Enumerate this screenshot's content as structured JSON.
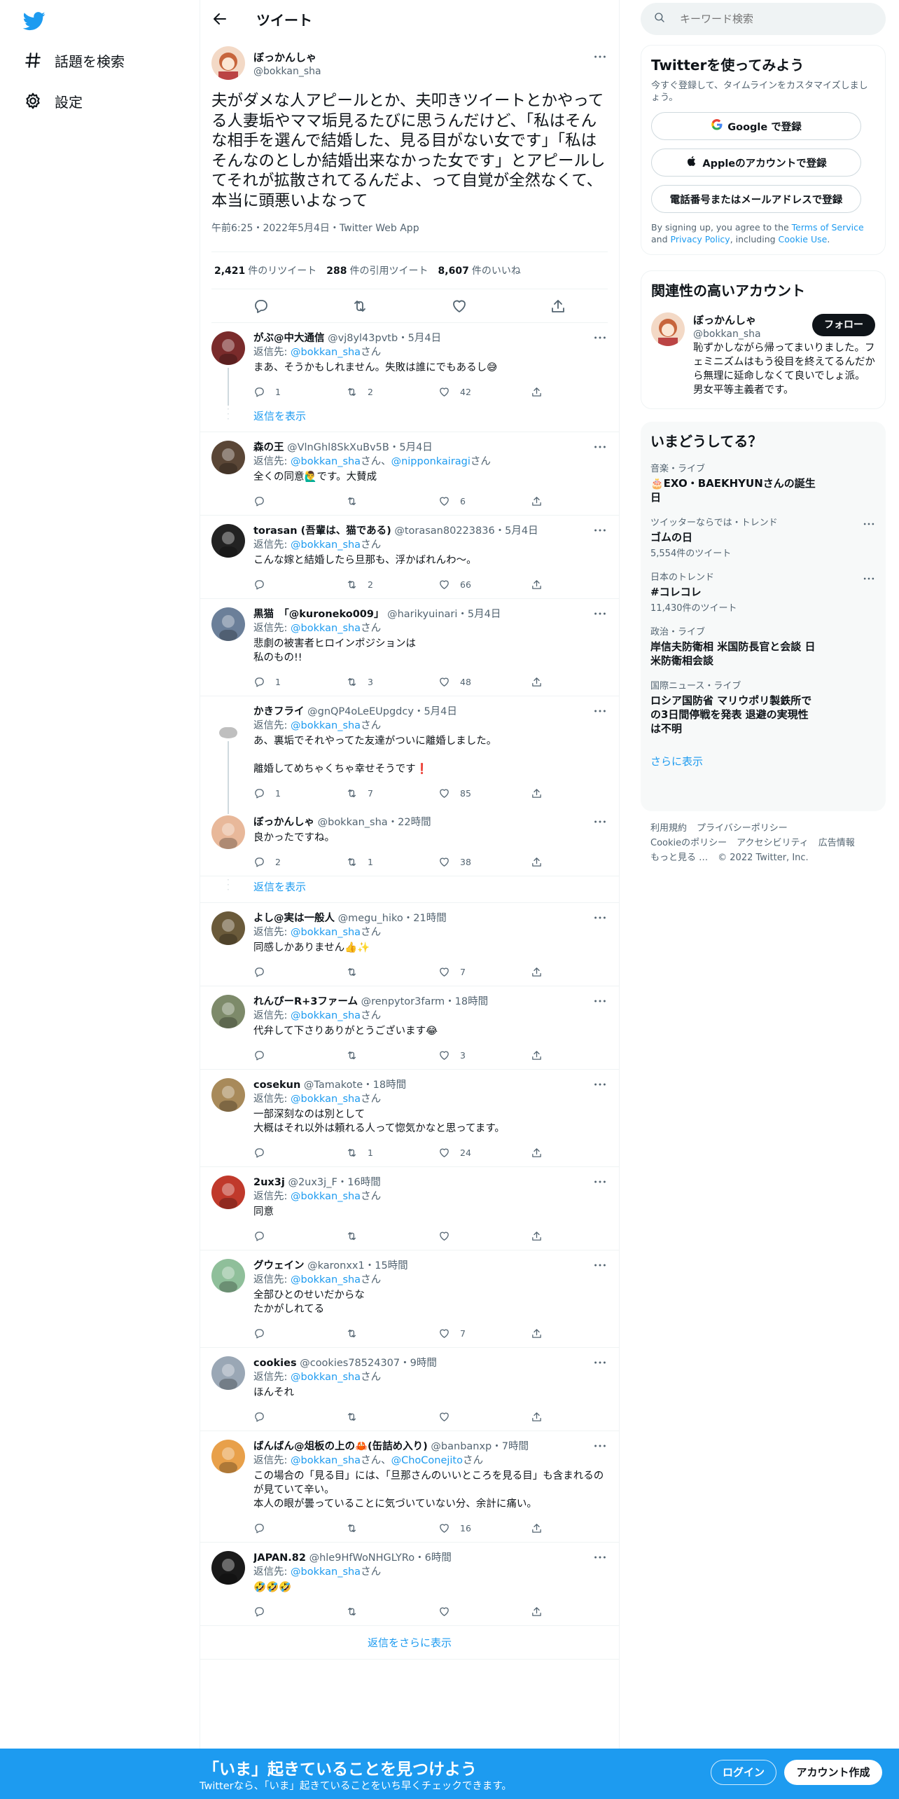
{
  "nav": {
    "logo": "twitter-logo",
    "items": [
      {
        "label": "話題を検索",
        "icon": "hashtag-icon"
      },
      {
        "label": "設定",
        "icon": "gear-icon"
      }
    ]
  },
  "header": {
    "title": "ツイート"
  },
  "tweet": {
    "name": "ぼっかんしゃ",
    "handle": "@bokkan_sha",
    "text": "夫がダメな人アピールとか、夫叩きツイートとかやってる人妻垢やママ垢見るたびに思うんだけど、「私はそんな相手を選んで結婚した、見る目がない女です」「私はそんなのとしか結婚出来なかった女です」とアピールしてそれが拡散されてるんだよ、って自覚が全然なくて、本当に頭悪いよなって",
    "meta": "午前6:25・2022年5月4日・Twitter Web App",
    "stats": [
      {
        "num": "2,421",
        "label": "件のリツイート"
      },
      {
        "num": "288",
        "label": "件の引用ツイート"
      },
      {
        "num": "8,607",
        "label": "件のいいね"
      }
    ]
  },
  "reply_prefix": "返信先: ",
  "reply_suffix": "さん",
  "show_thread": "返信を表示",
  "replies": [
    {
      "name": "がぶ@中大通信",
      "handle": "@vj8yl43pvtb",
      "time": "・5月4日",
      "to": "@bokkan_sha",
      "to2": "",
      "text": "まあ、そうかもしれません。失敗は誰にでもあるし😅",
      "reply": "1",
      "rt": "2",
      "like": "42",
      "color": "#7a2b2b"
    },
    {
      "name": "森の王",
      "handle": "@VlnGhl8SkXuBv5B",
      "time": "・5月4日",
      "to": "@bokkan_sha",
      "to2": "@nipponkairagi",
      "text": "全くの同意🙋‍♂️です。大賛成",
      "reply": "",
      "rt": "",
      "like": "6",
      "color": "#5a4636"
    },
    {
      "name": "torasan (吾輩は、猫である)",
      "handle": "@torasan80223836",
      "time": "・5月4日",
      "to": "@bokkan_sha",
      "to2": "",
      "text": "こんな嫁と結婚したら旦那も、浮かばれんわ〜。",
      "reply": "",
      "rt": "2",
      "like": "66",
      "color": "#222222"
    },
    {
      "name": "黒猫　「@kuroneko009」",
      "handle": "@harikyuinari",
      "time": "・5月4日",
      "to": "@bokkan_sha",
      "to2": "",
      "text": "悲劇の被害者ヒロインポジションは\n私のもの!!",
      "reply": "1",
      "rt": "3",
      "like": "48",
      "color": "#6b7f99"
    },
    {
      "name": "かきフライ",
      "handle": "@gnQP4oLeEUpgdcy",
      "time": "・5月4日",
      "to": "@bokkan_sha",
      "to2": "",
      "text": "あ、裏垢でそれやってた友達がついに離婚しました。\n\n離婚してめちゃくちゃ幸せそうです❗",
      "reply": "1",
      "rt": "7",
      "like": "85",
      "color": "#ffffff"
    },
    {
      "name": "ぼっかんしゃ",
      "handle": "@bokkan_sha",
      "time": "・22時間",
      "to": "",
      "to2": "",
      "text": "良かったですね。",
      "reply": "2",
      "rt": "1",
      "like": "38",
      "color": "#e8b89a"
    },
    {
      "name": "よし@実は一般人",
      "handle": "@megu_hiko",
      "time": "・21時間",
      "to": "@bokkan_sha",
      "to2": "",
      "text": "同感しかありません👍✨",
      "reply": "",
      "rt": "",
      "like": "7",
      "color": "#6a5a3a"
    },
    {
      "name": "れんぴーR+3ファーム",
      "handle": "@renpytor3farm",
      "time": "・18時間",
      "to": "@bokkan_sha",
      "to2": "",
      "text": "代弁して下さりありがとうございます😂",
      "reply": "",
      "rt": "",
      "like": "3",
      "color": "#7d8a6a"
    },
    {
      "name": "cosekun",
      "handle": "@Tamakote",
      "time": "・18時間",
      "to": "@bokkan_sha",
      "to2": "",
      "text": "一部深刻なのは別として\n大概はそれ以外は頼れる人って惚気かなと思ってます。",
      "reply": "",
      "rt": "1",
      "like": "24",
      "color": "#a88a5a"
    },
    {
      "name": "2ux3j",
      "handle": "@2ux3j_F",
      "time": "・16時間",
      "to": "@bokkan_sha",
      "to2": "",
      "text": "同意",
      "reply": "",
      "rt": "",
      "like": "",
      "color": "#c0392b"
    },
    {
      "name": "グウェイン",
      "handle": "@karonxx1",
      "time": "・15時間",
      "to": "@bokkan_sha",
      "to2": "",
      "text": "全部ひとのせいだからな\nたかがしれてる",
      "reply": "",
      "rt": "",
      "like": "7",
      "color": "#8fbf9a"
    },
    {
      "name": "cookies",
      "handle": "@cookies78524307",
      "time": "・9時間",
      "to": "@bokkan_sha",
      "to2": "",
      "text": "ほんそれ",
      "reply": "",
      "rt": "",
      "like": "",
      "color": "#9aa7b5"
    },
    {
      "name": "ばんばん@俎板の上の🦀(缶詰め入り)",
      "handle": "@banbanxp",
      "time": "・7時間",
      "to": "@bokkan_sha",
      "to2": "@ChoConejito",
      "text": "この場合の「見る目」には、「旦那さんのいいところを見る目」も含まれるのが見ていて辛い。\n本人の眼が曇っていることに気づいていない分、余計に痛い。",
      "reply": "",
      "rt": "",
      "like": "16",
      "color": "#e8a04a"
    },
    {
      "name": "JAPAN.82",
      "handle": "@hle9HfWoNHGLYRo",
      "time": "・6時間",
      "to": "@bokkan_sha",
      "to2": "",
      "text": "🤣🤣🤣",
      "reply": "",
      "rt": "",
      "like": "",
      "color": "#1a1a1a"
    }
  ],
  "more_replies": "返信をさらに表示",
  "search": {
    "placeholder": "キーワード検索"
  },
  "signup_card": {
    "title": "Twitterを使ってみよう",
    "sub": "今すぐ登録して、タイムラインをカスタマイズしましょう。",
    "google": "Google で登録",
    "apple": "Appleのアカウントで登録",
    "phone": "電話番号またはメールアドレスで登録",
    "legal_a": "By signing up, you agree to the ",
    "tos": "Terms of Service",
    "legal_b": " and ",
    "privacy": "Privacy Policy",
    "legal_c": ", including ",
    "cookie": "Cookie Use",
    "legal_d": "."
  },
  "related": {
    "title": "関連性の高いアカウント",
    "name": "ぼっかんしゃ",
    "handle": "@bokkan_sha",
    "bio": "恥ずかしながら帰ってまいりました。フェミニズムはもう役目を終えてるんだから無理に延命しなくて良いでしょ派。男女平等主義者です。",
    "follow": "フォロー"
  },
  "trends": {
    "title": "いまどうしてる？",
    "items": [
      {
        "cat": "音楽・ライブ",
        "title": "🎂EXO・BAEKHYUNさんの誕生日",
        "count": "",
        "more": false
      },
      {
        "cat": "ツイッターならでは・トレンド",
        "title": "ゴムの日",
        "count": "5,554件のツイート",
        "more": true
      },
      {
        "cat": "日本のトレンド",
        "title": "#コレコレ",
        "count": "11,430件のツイート",
        "more": true
      },
      {
        "cat": "政治・ライブ",
        "title": "岸信夫防衛相 米国防長官と会談 日米防衛相会談",
        "count": "",
        "more": false
      },
      {
        "cat": "国際ニュース・ライブ",
        "title": "ロシア国防省 マリウポリ製鉄所での3日間停戦を発表 退避の実現性は不明",
        "count": "",
        "more": false
      }
    ],
    "show_all": "さらに表示"
  },
  "footer": {
    "links": [
      "利用規約",
      "プライバシーポリシー",
      "Cookieのポリシー",
      "アクセシビリティ",
      "広告情報",
      "もっと見る …",
      "© 2022 Twitter, Inc."
    ]
  },
  "bottom": {
    "title": "「いま」起きていることを見つけよう",
    "sub": "Twitterなら、「いま」起きていることをいち早くチェックできます。",
    "login": "ログイン",
    "signup": "アカウント作成"
  },
  "colors": {
    "accent": "#1d9bf0",
    "text": "#0f1419",
    "muted": "#536471"
  }
}
